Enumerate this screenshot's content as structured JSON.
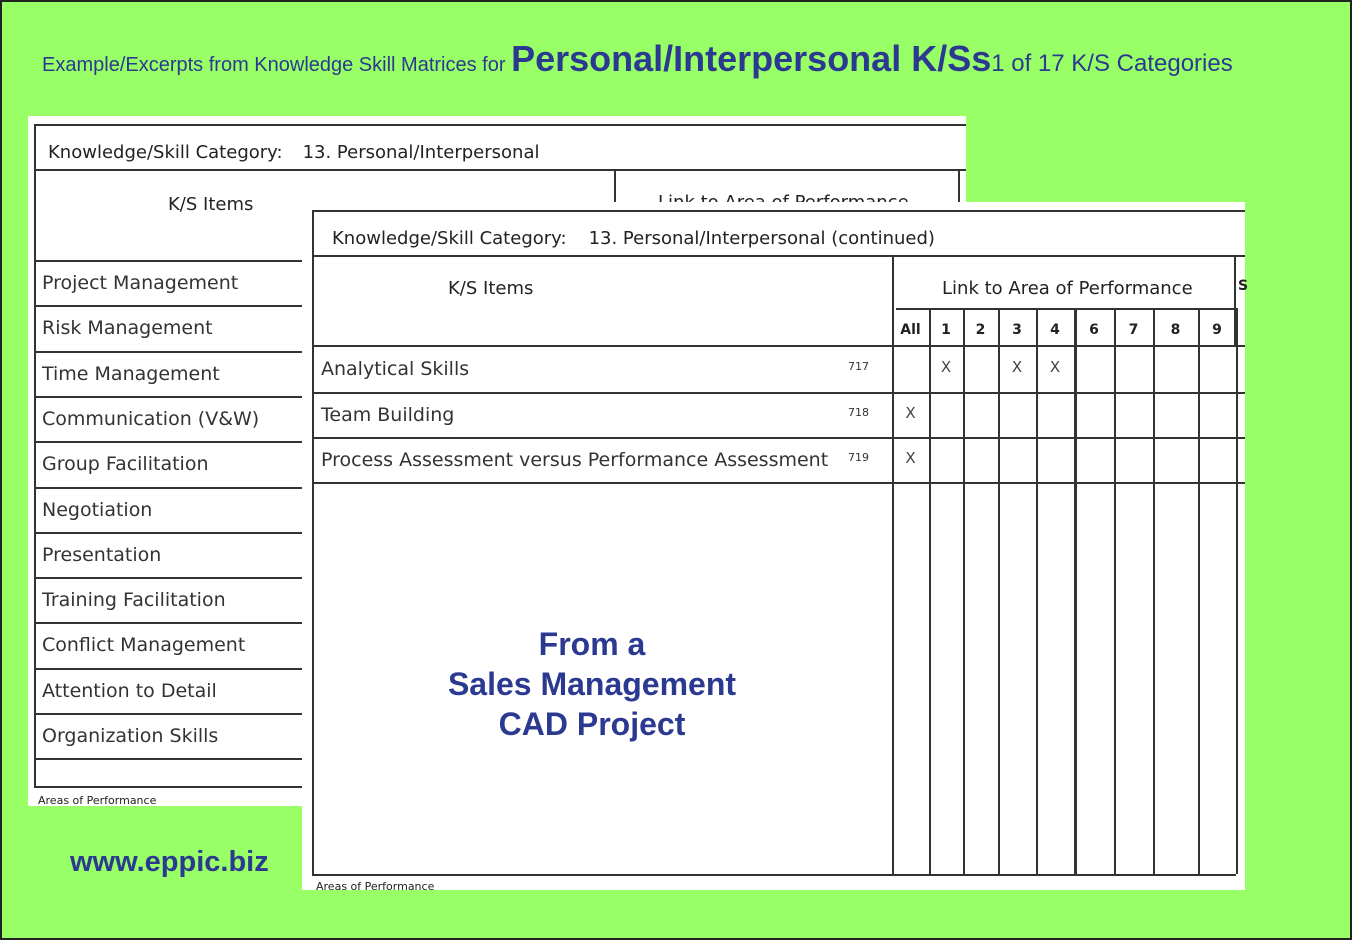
{
  "header": {
    "intro": "Example/Excerpts from Knowledge Skill Matrices for ",
    "emphasis": "Personal/Interpersonal K/Ss",
    "tail": "1 of 17 K/S Categories"
  },
  "back_sheet": {
    "category_label": "Knowledge/Skill Category:",
    "category_value": "13. Personal/Interpersonal",
    "items_header": "K/S Items",
    "link_header": "Link to Area of Performance",
    "items": [
      "Project Management",
      "Risk Management",
      "Time Management",
      "Communication (V&W)",
      "Group Facilitation",
      "Negotiation",
      "Presentation",
      "Training Facilitation",
      "Conflict Management",
      "Attention to Detail",
      "Organization Skills"
    ],
    "footer": "Areas of Performance"
  },
  "front_sheet": {
    "category_label": "Knowledge/Skill Category:",
    "category_value": "13. Personal/Interpersonal (continued)",
    "items_header": "K/S Items",
    "link_header": "Link to Area of Performance",
    "next_header_truncated": "S",
    "columns": [
      "All",
      "1",
      "2",
      "3",
      "4",
      "6",
      "7",
      "8",
      "9"
    ],
    "rows": [
      {
        "item": "Analytical Skills",
        "num": "717",
        "marks": [
          "",
          "X",
          "",
          "X",
          "X",
          "",
          "",
          "",
          ""
        ]
      },
      {
        "item": "Team Building",
        "num": "718",
        "marks": [
          "X",
          "",
          "",
          "",
          "",
          "",
          "",
          "",
          ""
        ]
      },
      {
        "item": "Process Assessment versus Performance Assessment",
        "num": "719",
        "marks": [
          "X",
          "",
          "",
          "",
          "",
          "",
          "",
          "",
          ""
        ]
      }
    ],
    "mark_symbol": "X",
    "footer": "Areas of Performance"
  },
  "overlay": {
    "line1": "From a",
    "line2": "Sales Management",
    "line3": "CAD Project"
  },
  "website": "www.eppic.biz",
  "colors": {
    "background": "#99ff66",
    "title_text": "#2b3990"
  }
}
